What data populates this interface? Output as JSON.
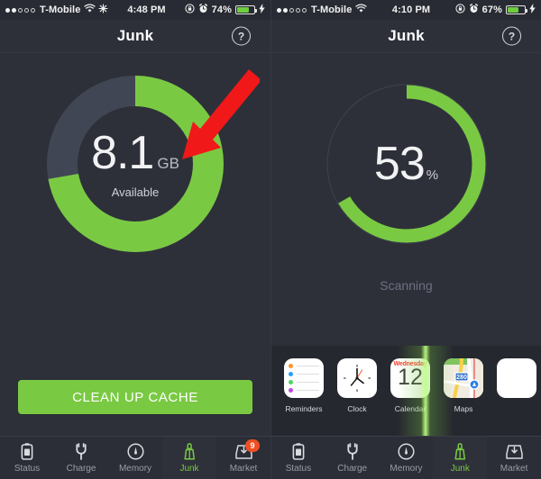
{
  "colors": {
    "background": "#2d3039",
    "green": "#7ac943",
    "track_gray": "#414654",
    "badge": "#f04e23",
    "text_muted": "#9a9da6"
  },
  "left": {
    "statusbar": {
      "carrier": "T-Mobile",
      "signal_dots_filled": 2,
      "signal_dots_total": 5,
      "wifi_icon": "wifi-icon",
      "extra_icon": "bluetooth-sync-icon",
      "time": "4:48 PM",
      "rotation_lock_icon": "rotation-lock-icon",
      "alarm_icon": "alarm-clock-icon",
      "battery_percent": "74%",
      "battery_level": 74,
      "charging_icon": "lightning-bolt-icon"
    },
    "navbar": {
      "title": "Junk",
      "help_label": "?"
    },
    "donut": {
      "value": "8.1",
      "unit": "GB",
      "sublabel": "Available",
      "green_percent": 72,
      "gray_percent": 28,
      "green_sweep_deg": 260,
      "track_color": "#414654",
      "arc_color": "#7ac943"
    },
    "button": {
      "label": "CLEAN UP CACHE"
    },
    "arrow": {
      "name": "red-pointer-arrow",
      "color": "#f01818"
    },
    "tabs": [
      {
        "label": "Status",
        "icon": "battery-status-icon",
        "active": false,
        "badge": null
      },
      {
        "label": "Charge",
        "icon": "power-plug-icon",
        "active": false,
        "badge": null
      },
      {
        "label": "Memory",
        "icon": "gauge-icon",
        "active": false,
        "badge": null
      },
      {
        "label": "Junk",
        "icon": "broom-icon",
        "active": true,
        "badge": null
      },
      {
        "label": "Market",
        "icon": "download-tray-icon",
        "active": false,
        "badge": "9"
      }
    ]
  },
  "right": {
    "statusbar": {
      "carrier": "T-Mobile",
      "signal_dots_filled": 2,
      "signal_dots_total": 5,
      "wifi_icon": "wifi-icon",
      "time": "4:10 PM",
      "rotation_lock_icon": "rotation-lock-icon",
      "alarm_icon": "alarm-clock-icon",
      "battery_percent": "67%",
      "battery_level": 67,
      "charging_icon": "lightning-bolt-icon"
    },
    "navbar": {
      "title": "Junk",
      "help_label": "?"
    },
    "donut": {
      "value": "53",
      "unit": "%",
      "green_percent": 53,
      "green_sweep_deg": 240,
      "ring_color": "#3a3e49",
      "arc_color": "#7ac943"
    },
    "status_text": "Scanning",
    "apps": [
      {
        "name": "Reminders",
        "icon": "reminders-app-icon"
      },
      {
        "name": "Clock",
        "icon": "clock-app-icon"
      },
      {
        "name": "Calendar",
        "icon": "calendar-app-icon",
        "weekday": "Wednesday",
        "day": "12"
      },
      {
        "name": "Maps",
        "icon": "maps-app-icon",
        "route_shield": "280"
      },
      {
        "name": "",
        "icon": "partial-app-icon"
      }
    ],
    "tabs": [
      {
        "label": "Status",
        "icon": "battery-status-icon",
        "active": false,
        "badge": null
      },
      {
        "label": "Charge",
        "icon": "power-plug-icon",
        "active": false,
        "badge": null
      },
      {
        "label": "Memory",
        "icon": "gauge-icon",
        "active": false,
        "badge": null
      },
      {
        "label": "Junk",
        "icon": "broom-icon",
        "active": true,
        "badge": null
      },
      {
        "label": "Market",
        "icon": "download-tray-icon",
        "active": false,
        "badge": null
      }
    ]
  }
}
